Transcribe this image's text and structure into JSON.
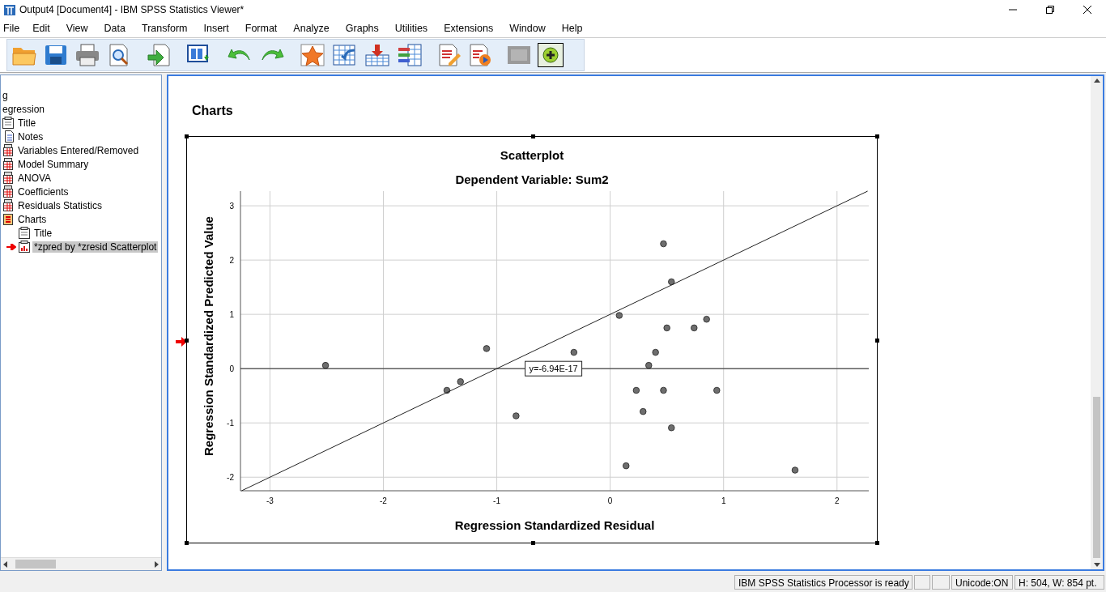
{
  "window": {
    "title": "Output4 [Document4] - IBM SPSS Statistics Viewer*"
  },
  "menu": [
    "File",
    "Edit",
    "View",
    "Data",
    "Transform",
    "Insert",
    "Format",
    "Analyze",
    "Graphs",
    "Utilities",
    "Extensions",
    "Window",
    "Help"
  ],
  "outline": [
    {
      "label": "g",
      "selected": false
    },
    {
      "label": "egression",
      "selected": false,
      "children": [
        {
          "label": "Title",
          "kind": "text",
          "selected": false
        },
        {
          "label": "Notes",
          "kind": "notes",
          "selected": false
        },
        {
          "label": "Variables Entered/Removed",
          "kind": "table",
          "selected": false
        },
        {
          "label": "Model Summary",
          "kind": "table",
          "selected": false
        },
        {
          "label": "ANOVA",
          "kind": "table",
          "selected": false
        },
        {
          "label": "Coefficients",
          "kind": "table",
          "selected": false
        },
        {
          "label": "Residuals Statistics",
          "kind": "table",
          "selected": false
        },
        {
          "label": "Charts",
          "kind": "folder",
          "selected": false,
          "children": [
            {
              "label": "Title",
              "kind": "text",
              "selected": false
            },
            {
              "label": "*zpred by *zresid Scatterplot",
              "kind": "chart",
              "selected": true
            }
          ]
        }
      ]
    }
  ],
  "content": {
    "heading": "Charts",
    "chart_data": {
      "type": "scatter",
      "title": "Scatterplot",
      "subtitle": "Dependent Variable: Sum2",
      "xlabel": "Regression Standardized Residual",
      "ylabel": "Regression Standardized Predicted Value",
      "x": [
        -2.51,
        -1.44,
        -1.32,
        -1.09,
        -0.83,
        -0.32,
        0.08,
        0.47,
        0.54,
        0.5,
        0.74,
        0.85,
        0.4,
        0.34,
        0.23,
        0.47,
        0.94,
        0.29,
        0.54,
        0.14,
        1.63
      ],
      "series": [
        {
          "color": "#6e6e6e",
          "values": [
            0.06,
            -0.4,
            -0.24,
            0.37,
            -0.87,
            0.3,
            0.98,
            2.3,
            1.6,
            0.75,
            0.75,
            0.91,
            0.3,
            0.06,
            -0.4,
            -0.4,
            -0.4,
            -0.79,
            -1.09,
            -1.79,
            -1.87
          ]
        },
        {
          "type": "line",
          "color": "#222222",
          "x": [
            -3.25,
            2.27
          ],
          "values": [
            -2.25,
            3.27
          ]
        }
      ],
      "xlim": [
        -3.26,
        2.28
      ],
      "ylim": [
        -2.25,
        3.27
      ],
      "xticks": [
        -3,
        -2,
        -1,
        0,
        1,
        2
      ],
      "yticks": [
        -2,
        -1,
        0,
        1,
        2,
        3
      ],
      "grid": true,
      "ref_lines": [
        {
          "axis": "y",
          "value": -6.94e-17
        }
      ],
      "annotations": [
        {
          "text": "y=-6.94E-17",
          "x": -0.5,
          "y": 0
        }
      ]
    }
  },
  "status_bar": [
    "IBM SPSS Statistics Processor is ready",
    "Unicode:ON",
    "H: 504, W: 854 pt."
  ]
}
